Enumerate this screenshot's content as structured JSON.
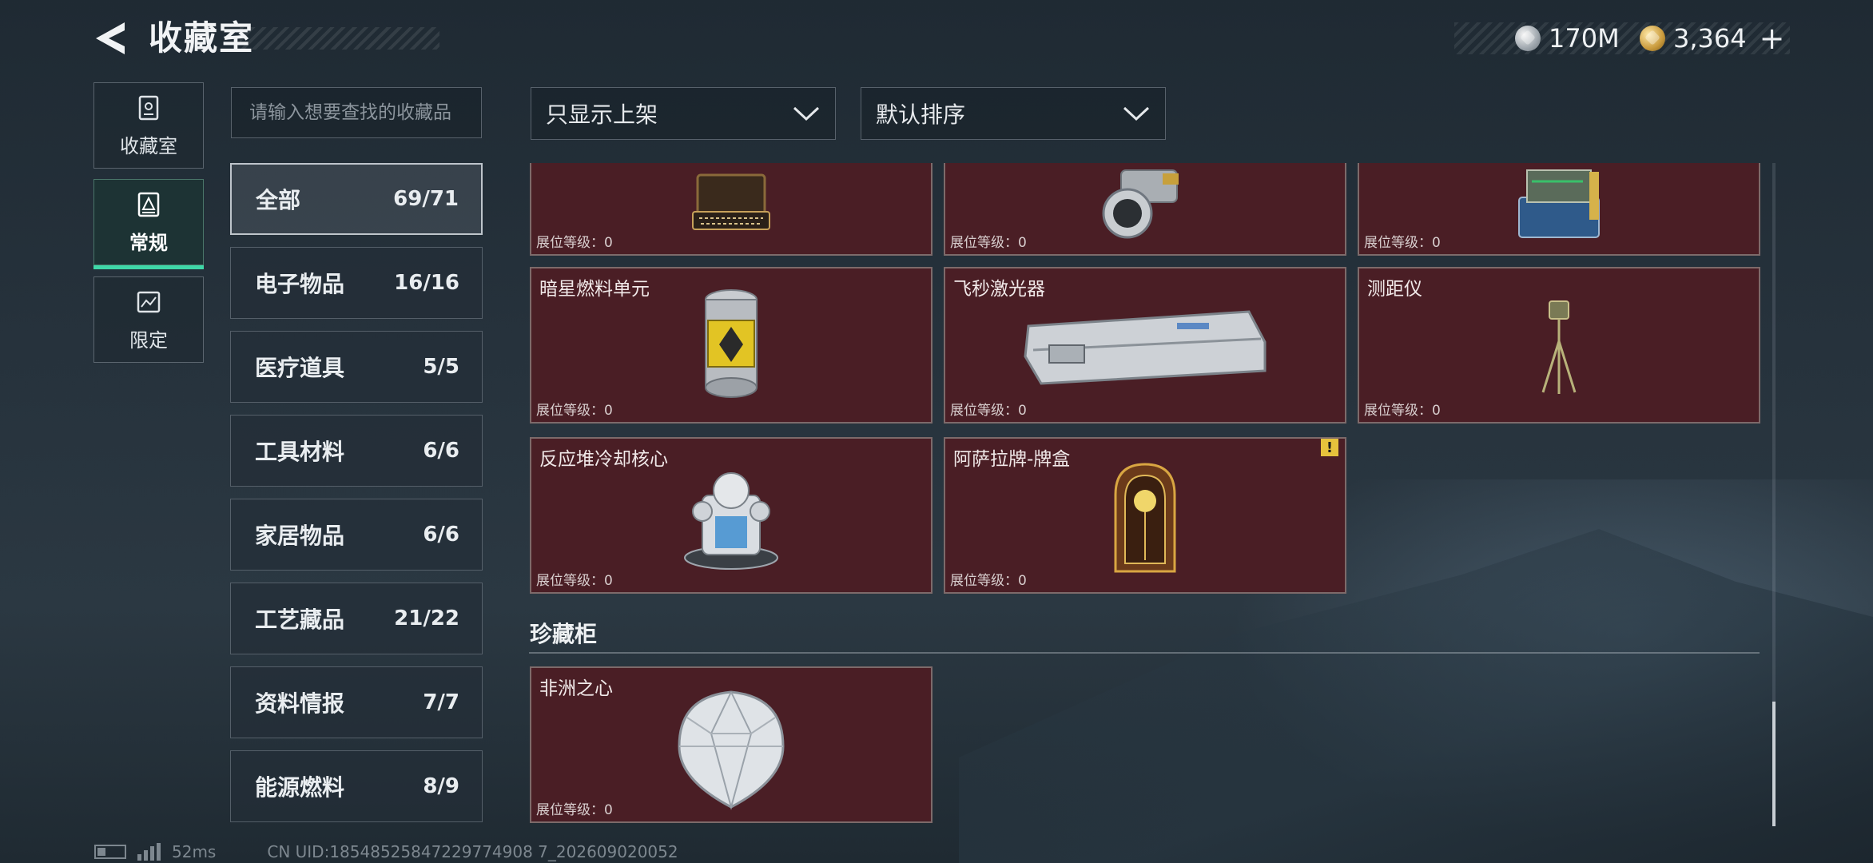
{
  "header": {
    "title": "收藏室",
    "currencies": [
      {
        "icon": "silver-coin-icon",
        "amount": "170M"
      },
      {
        "icon": "gold-coin-icon",
        "amount": "3,364"
      }
    ],
    "add_label": "+"
  },
  "leftnav": {
    "items": [
      {
        "label": "收藏室",
        "icon": "collection-room-icon",
        "active": false
      },
      {
        "label": "常规",
        "icon": "regular-icon",
        "active": true
      },
      {
        "label": "限定",
        "icon": "limited-icon",
        "active": false
      }
    ]
  },
  "search": {
    "placeholder": "请输入想要查找的收藏品"
  },
  "categories": [
    {
      "name": "全部",
      "count": "69/71",
      "active": true
    },
    {
      "name": "电子物品",
      "count": "16/16"
    },
    {
      "name": "医疗道具",
      "count": "5/5"
    },
    {
      "name": "工具材料",
      "count": "6/6"
    },
    {
      "name": "家居物品",
      "count": "6/6"
    },
    {
      "name": "工艺藏品",
      "count": "21/22"
    },
    {
      "name": "资料情报",
      "count": "7/7"
    },
    {
      "name": "能源燃料",
      "count": "8/9"
    }
  ],
  "filters": {
    "listing": "只显示上架",
    "sort": "默认排序"
  },
  "items": [
    {
      "name": "",
      "level": "展位等级：0",
      "art": "typewriter"
    },
    {
      "name": "",
      "level": "展位等级：0",
      "art": "lens"
    },
    {
      "name": "",
      "level": "展位等级：0",
      "art": "machine"
    },
    {
      "name": "暗星燃料单元",
      "level": "展位等级：0",
      "art": "canister"
    },
    {
      "name": "飞秒激光器",
      "level": "展位等级：0",
      "art": "laser"
    },
    {
      "name": "测距仪",
      "level": "展位等级：0",
      "art": "tripod"
    },
    {
      "name": "反应堆冷却核心",
      "level": "展位等级：0",
      "art": "core"
    },
    {
      "name": "阿萨拉牌-牌盒",
      "level": "展位等级：0",
      "art": "cardbox",
      "warning": "!"
    }
  ],
  "treasure_section": {
    "title": "珍藏柜",
    "items": [
      {
        "name": "非洲之心",
        "level": "展位等级：0",
        "art": "diamond"
      }
    ]
  },
  "footer": {
    "ping": "52ms",
    "uid": "CN UID:18548525847229774908 7_202609020052"
  }
}
